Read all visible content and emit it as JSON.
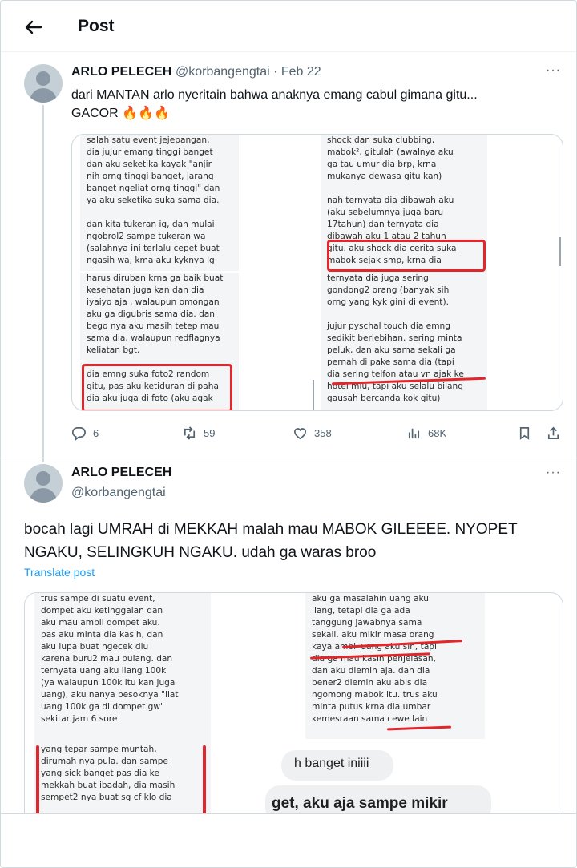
{
  "header": {
    "title": "Post"
  },
  "colors": {
    "accent": "#1d9bf0",
    "highlight": "#e2262b",
    "text": "#0f1419",
    "muted": "#536471"
  },
  "tweet1": {
    "name": "ARLO PELECEH",
    "handle_date": "@korbangengtai · Feb 22",
    "text_line1": "dari MANTAN arlo nyeritain bahwa anaknya emang cabul gimana gitu...",
    "text_line2": "GACOR 🔥🔥🔥",
    "image": {
      "p1": "salah satu event jejepangan,\ndia jujur emang tinggi banget\ndan aku seketika kayak \"anjir\nnih orng tinggi banget, jarang\nbanget ngeliat orng tinggi\" dan\nya aku seketika suka sama dia.\n\ndan kita tukeran ig, dan mulai\nngobrol2 sampe tukeran wa\n(salahnya ini terlalu cepet buat\nngasih wa, kma aku kyknya lg",
      "p2": "harus diruban krna ga baik buat\nkesehatan juga kan dan dia\niyaiyo aja , walaupun omongan\naku ga digubris sama dia. dan\nbego nya aku masih tetep mau\nsama dia, walaupun redflagnya\nkeliatan bgt.\n\ndia emng suka foto2 random\ngitu, pas aku ketiduran di paha\ndia aku juga di foto (aku agak",
      "p3": "shock dan suka clubbing,\nmabok², gitulah (awalnya aku\nga tau umur dia brp, krna\nmukanya dewasa gitu kan)\n\nnah ternyata dia dibawah aku\n(aku sebelumnya juga baru\n17tahun) dan ternyata dia\ndibawah aku 1 atau 2 tahun\ngitu. aku shock dia cerita suka\nmabok sejak smp, krna dia",
      "p4": "ternyata dia juga sering\ngondong2 orang (banyak sih\norng yang kyk gini di event).\n\njujur pyschal touch dia emng\nsedikit berlebihan. sering minta\npeluk, dan aku sama sekali ga\npernah di pake sama dia (tapi\ndia sering telfon atau vn ajak ke\nhotel mlu, tapi aku selalu bilang\ngausah bercanda kok gitu)"
    },
    "actions": {
      "replies": "6",
      "reposts": "59",
      "likes": "358",
      "views": "68K"
    }
  },
  "tweet2": {
    "name": "ARLO PELECEH",
    "handle": "@korbangengtai",
    "text_line1": "bocah lagi UMRAH di MEKKAH malah mau MABOK GILEEEE. NYOPET",
    "text_line2": "NGAKU, SELINGKUH NGAKU. udah ga waras broo",
    "translate": "Translate post",
    "image": {
      "p1": "trus sampe di suatu event,\ndompet aku ketinggalan dan\naku mau ambil dompet aku.\npas aku minta dia kasih, dan\naku lupa buat ngecek dlu\nkarena buru2 mau pulang. dan\nternyata uang aku ilang 100k\n(ya walaupun 100k itu kan juga\nuang), aku nanya besoknya \"liat\nuang 100k ga di dompet gw\"\nsekitar jam 6 sore",
      "p2": "yang tepar sampe muntah,\ndirumah nya pula. dan sampe\nyang sick banget pas dia ke\nmekkah buat ibadah, dia masih\nsempet2 nya buat sg cf klo dia",
      "p3": "aku ga masalahin uang aku\nilang, tetapi dia ga ada\ntanggung jawabnya sama\nsekali. aku mikir masa orang\nkaya ambil uang aku sih, tapi\ndia ga mau kasih penjelasan,\ndan aku diemin aja. dan dia\nbener2 diemin aku abis dia\nngomong mabok itu. trus aku\nminta putus krna dia umbar\nkemesraan sama cewe lain",
      "bubble1": "h banget iniiii",
      "bubble2": "get, aku aja sampe mikir"
    }
  }
}
